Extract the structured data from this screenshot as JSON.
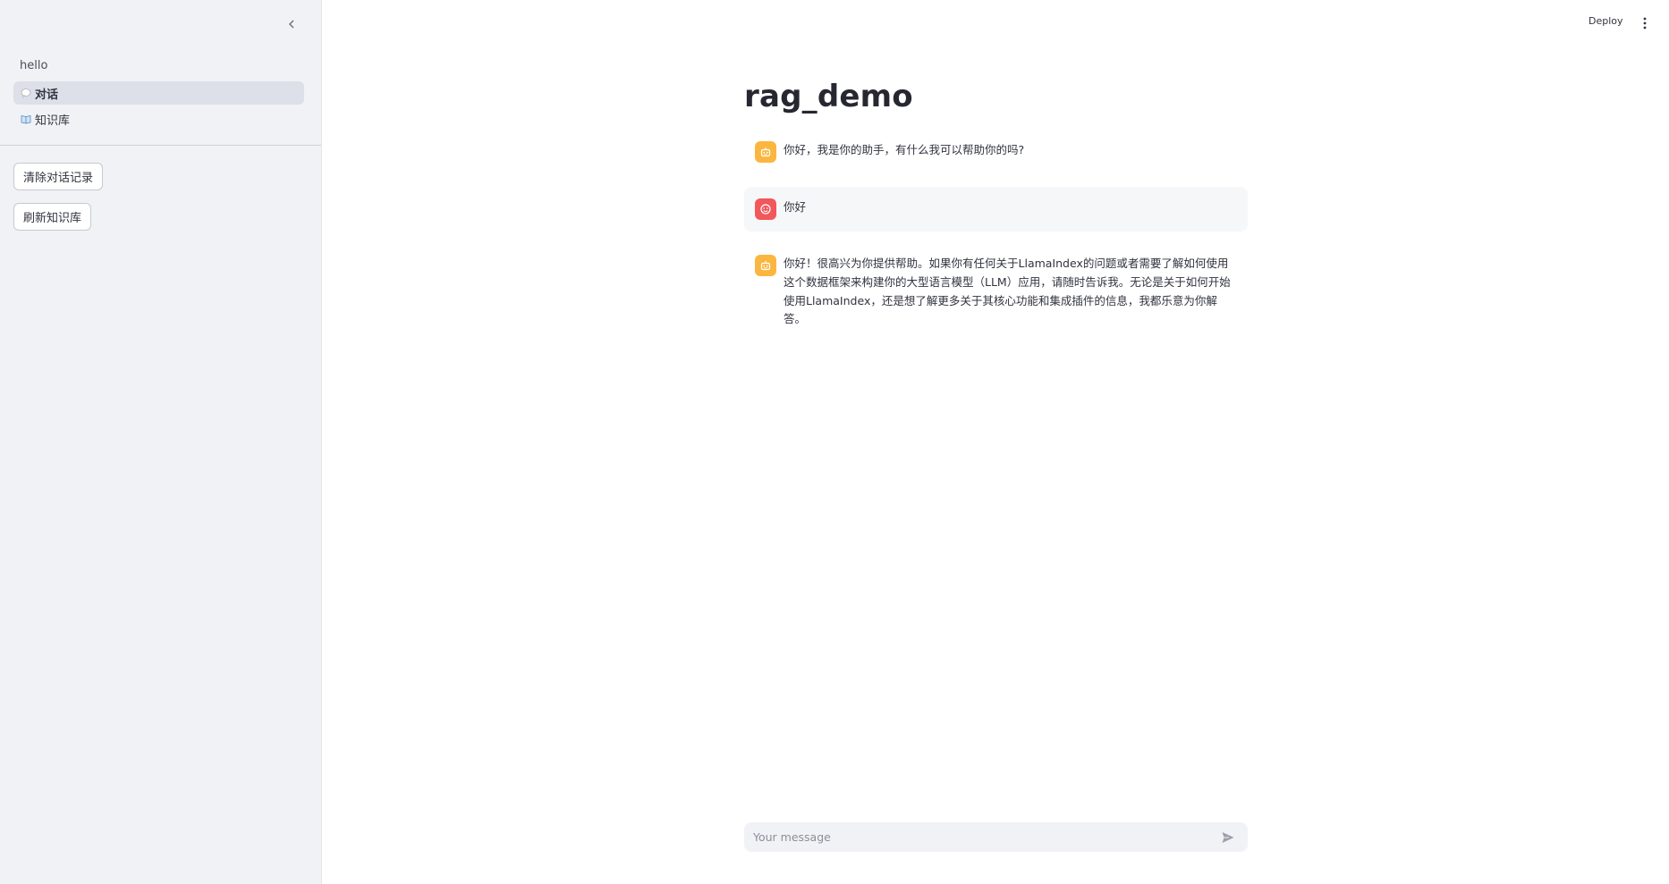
{
  "sidebar": {
    "app_label": "hello",
    "nav": [
      {
        "label": "对话",
        "icon": "speech-bubble-icon",
        "active": true
      },
      {
        "label": "知识库",
        "icon": "book-icon",
        "active": false
      }
    ],
    "buttons": {
      "clear_history": "清除对话记录",
      "refresh_kb": "刷新知识库"
    }
  },
  "topbar": {
    "deploy_label": "Deploy",
    "menu_icon": "kebab-menu-icon"
  },
  "main": {
    "title": "rag_demo",
    "messages": [
      {
        "role": "assistant",
        "avatar_icon": "bot-icon",
        "text": "你好，我是你的助手，有什么我可以帮助你的吗?"
      },
      {
        "role": "user",
        "avatar_icon": "user-face-icon",
        "text": "你好"
      },
      {
        "role": "assistant",
        "avatar_icon": "bot-icon",
        "text": "你好！很高兴为你提供帮助。如果你有任何关于LlamaIndex的问题或者需要了解如何使用这个数据框架来构建你的大型语言模型（LLM）应用，请随时告诉我。无论是关于如何开始使用LlamaIndex，还是想了解更多关于其核心功能和集成插件的信息，我都乐意为你解答。"
      }
    ],
    "chat_input": {
      "placeholder": "Your message",
      "value": "",
      "send_icon": "send-icon"
    }
  },
  "colors": {
    "sidebar_bg": "#f0f2f6",
    "bot_avatar": "#fbb640",
    "user_avatar": "#f2575a",
    "user_message_bg": "#f6f7f9"
  }
}
